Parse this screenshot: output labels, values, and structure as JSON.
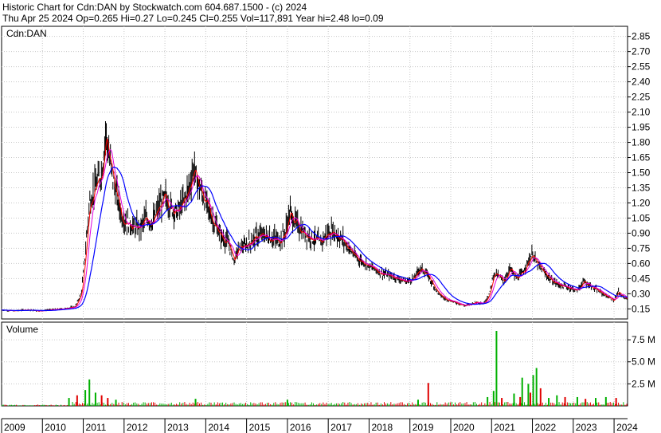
{
  "header": {
    "line1": "Historic Chart for Cdn:DAN by Stockwatch.com 604.687.1500 - (c) 2024",
    "line2": "Thu Apr 25 2024   Op=0.265   Hi=0.27   Lo=0.245   Cl=0.255   Vol=117,891   Year hi=2.48   lo=0.09"
  },
  "colors": {
    "bar": "#000000",
    "ma_short": "#ff0000",
    "ma_mid": "#e000e0",
    "ma_long": "#0000ff",
    "vol_up": "#00b000",
    "vol_down": "#e00000",
    "grid": "#c8c8c8"
  },
  "chart_data": [
    {
      "type": "line",
      "name": "price-panel",
      "title": "Cdn:DAN",
      "ylim": [
        0.05,
        2.95
      ],
      "y_ticks": [
        "2.85",
        "2.70",
        "2.55",
        "2.40",
        "2.25",
        "2.10",
        "1.95",
        "1.80",
        "1.65",
        "1.50",
        "1.35",
        "1.20",
        "1.05",
        "0.90",
        "0.75",
        "0.60",
        "0.45",
        "0.30",
        "0.15"
      ],
      "y_tick_values": [
        2.85,
        2.7,
        2.55,
        2.4,
        2.25,
        2.1,
        1.95,
        1.8,
        1.65,
        1.5,
        1.35,
        1.2,
        1.05,
        0.9,
        0.75,
        0.6,
        0.45,
        0.3,
        0.15
      ],
      "xlim": [
        2009.0,
        2024.33
      ],
      "x_ticks": [
        "2009",
        "2010",
        "2011",
        "2012",
        "2013",
        "2014",
        "2015",
        "2016",
        "2017",
        "2018",
        "2019",
        "2020",
        "2021",
        "2022",
        "2023",
        "2024"
      ],
      "x_tick_values": [
        2009,
        2010,
        2011,
        2012,
        2013,
        2014,
        2015,
        2016,
        2017,
        2018,
        2019,
        2020,
        2021,
        2022,
        2023,
        2024
      ],
      "grid": true,
      "price_anchors": [
        [
          2009.0,
          0.14
        ],
        [
          2009.3,
          0.13
        ],
        [
          2009.6,
          0.14
        ],
        [
          2009.9,
          0.13
        ],
        [
          2010.2,
          0.14
        ],
        [
          2010.5,
          0.15
        ],
        [
          2010.8,
          0.17
        ],
        [
          2010.95,
          0.3
        ],
        [
          2011.05,
          0.7
        ],
        [
          2011.15,
          1.2
        ],
        [
          2011.25,
          1.3
        ],
        [
          2011.35,
          1.4
        ],
        [
          2011.45,
          1.5
        ],
        [
          2011.55,
          1.9
        ],
        [
          2011.65,
          1.6
        ],
        [
          2011.8,
          1.3
        ],
        [
          2011.95,
          1.05
        ],
        [
          2012.1,
          1.0
        ],
        [
          2012.25,
          0.95
        ],
        [
          2012.4,
          0.95
        ],
        [
          2012.55,
          1.05
        ],
        [
          2012.7,
          1.0
        ],
        [
          2012.85,
          1.15
        ],
        [
          2013.0,
          1.25
        ],
        [
          2013.15,
          1.15
        ],
        [
          2013.3,
          1.1
        ],
        [
          2013.45,
          1.2
        ],
        [
          2013.6,
          1.35
        ],
        [
          2013.7,
          1.55
        ],
        [
          2013.8,
          1.4
        ],
        [
          2014.0,
          1.2
        ],
        [
          2014.2,
          1.0
        ],
        [
          2014.4,
          0.85
        ],
        [
          2014.55,
          0.8
        ],
        [
          2014.7,
          0.62
        ],
        [
          2014.8,
          0.75
        ],
        [
          2015.0,
          0.78
        ],
        [
          2015.2,
          0.85
        ],
        [
          2015.4,
          0.88
        ],
        [
          2015.6,
          0.85
        ],
        [
          2015.8,
          0.82
        ],
        [
          2015.95,
          0.9
        ],
        [
          2016.05,
          1.1
        ],
        [
          2016.2,
          1.0
        ],
        [
          2016.4,
          0.9
        ],
        [
          2016.6,
          0.85
        ],
        [
          2016.8,
          0.8
        ],
        [
          2016.95,
          0.88
        ],
        [
          2017.1,
          0.92
        ],
        [
          2017.3,
          0.85
        ],
        [
          2017.5,
          0.75
        ],
        [
          2017.7,
          0.65
        ],
        [
          2017.9,
          0.6
        ],
        [
          2018.1,
          0.55
        ],
        [
          2018.3,
          0.5
        ],
        [
          2018.5,
          0.48
        ],
        [
          2018.7,
          0.45
        ],
        [
          2018.9,
          0.42
        ],
        [
          2019.1,
          0.45
        ],
        [
          2019.25,
          0.55
        ],
        [
          2019.4,
          0.5
        ],
        [
          2019.55,
          0.4
        ],
        [
          2019.7,
          0.3
        ],
        [
          2019.85,
          0.25
        ],
        [
          2020.0,
          0.23
        ],
        [
          2020.2,
          0.2
        ],
        [
          2020.35,
          0.18
        ],
        [
          2020.5,
          0.2
        ],
        [
          2020.65,
          0.22
        ],
        [
          2020.8,
          0.2
        ],
        [
          2020.95,
          0.3
        ],
        [
          2021.05,
          0.5
        ],
        [
          2021.15,
          0.48
        ],
        [
          2021.3,
          0.42
        ],
        [
          2021.45,
          0.55
        ],
        [
          2021.6,
          0.45
        ],
        [
          2021.75,
          0.5
        ],
        [
          2021.9,
          0.62
        ],
        [
          2022.0,
          0.7
        ],
        [
          2022.1,
          0.6
        ],
        [
          2022.3,
          0.5
        ],
        [
          2022.5,
          0.42
        ],
        [
          2022.7,
          0.38
        ],
        [
          2022.9,
          0.36
        ],
        [
          2023.1,
          0.33
        ],
        [
          2023.25,
          0.42
        ],
        [
          2023.4,
          0.38
        ],
        [
          2023.6,
          0.33
        ],
        [
          2023.8,
          0.28
        ],
        [
          2024.0,
          0.23
        ],
        [
          2024.1,
          0.32
        ],
        [
          2024.2,
          0.27
        ],
        [
          2024.33,
          0.255
        ]
      ]
    },
    {
      "type": "bar",
      "name": "volume-panel",
      "title": "Volume",
      "ylim": [
        0,
        9.5
      ],
      "y_ticks": [
        "7.5 M",
        "5.0 M",
        "2.5 M"
      ],
      "y_tick_values": [
        7.5,
        5.0,
        2.5
      ],
      "grid": true,
      "volume_spikes": [
        [
          2010.65,
          0.9,
          "up"
        ],
        [
          2010.85,
          1.2,
          "down"
        ],
        [
          2011.05,
          1.8,
          "up"
        ],
        [
          2011.15,
          3.0,
          "up"
        ],
        [
          2011.3,
          1.5,
          "up"
        ],
        [
          2011.45,
          1.2,
          "down"
        ],
        [
          2011.6,
          0.9,
          "down"
        ],
        [
          2011.8,
          0.7,
          "up"
        ],
        [
          2013.75,
          0.8,
          "up"
        ],
        [
          2016.0,
          0.7,
          "up"
        ],
        [
          2019.2,
          0.7,
          "up"
        ],
        [
          2019.45,
          2.6,
          "down"
        ],
        [
          2020.9,
          1.0,
          "up"
        ],
        [
          2021.05,
          1.7,
          "up"
        ],
        [
          2021.12,
          8.5,
          "up"
        ],
        [
          2021.25,
          0.9,
          "down"
        ],
        [
          2021.55,
          1.4,
          "up"
        ],
        [
          2021.7,
          1.0,
          "down"
        ],
        [
          2021.75,
          3.2,
          "up"
        ],
        [
          2021.9,
          2.5,
          "up"
        ],
        [
          2021.95,
          1.5,
          "down"
        ],
        [
          2022.02,
          3.5,
          "up"
        ],
        [
          2022.1,
          4.3,
          "up"
        ],
        [
          2022.2,
          2.0,
          "down"
        ],
        [
          2022.4,
          0.9,
          "up"
        ],
        [
          2022.6,
          1.2,
          "up"
        ],
        [
          2022.8,
          1.0,
          "down"
        ],
        [
          2023.1,
          1.0,
          "up"
        ],
        [
          2023.3,
          0.8,
          "down"
        ],
        [
          2023.55,
          0.9,
          "up"
        ],
        [
          2023.8,
          1.0,
          "up"
        ],
        [
          2024.05,
          0.9,
          "down"
        ]
      ]
    }
  ]
}
